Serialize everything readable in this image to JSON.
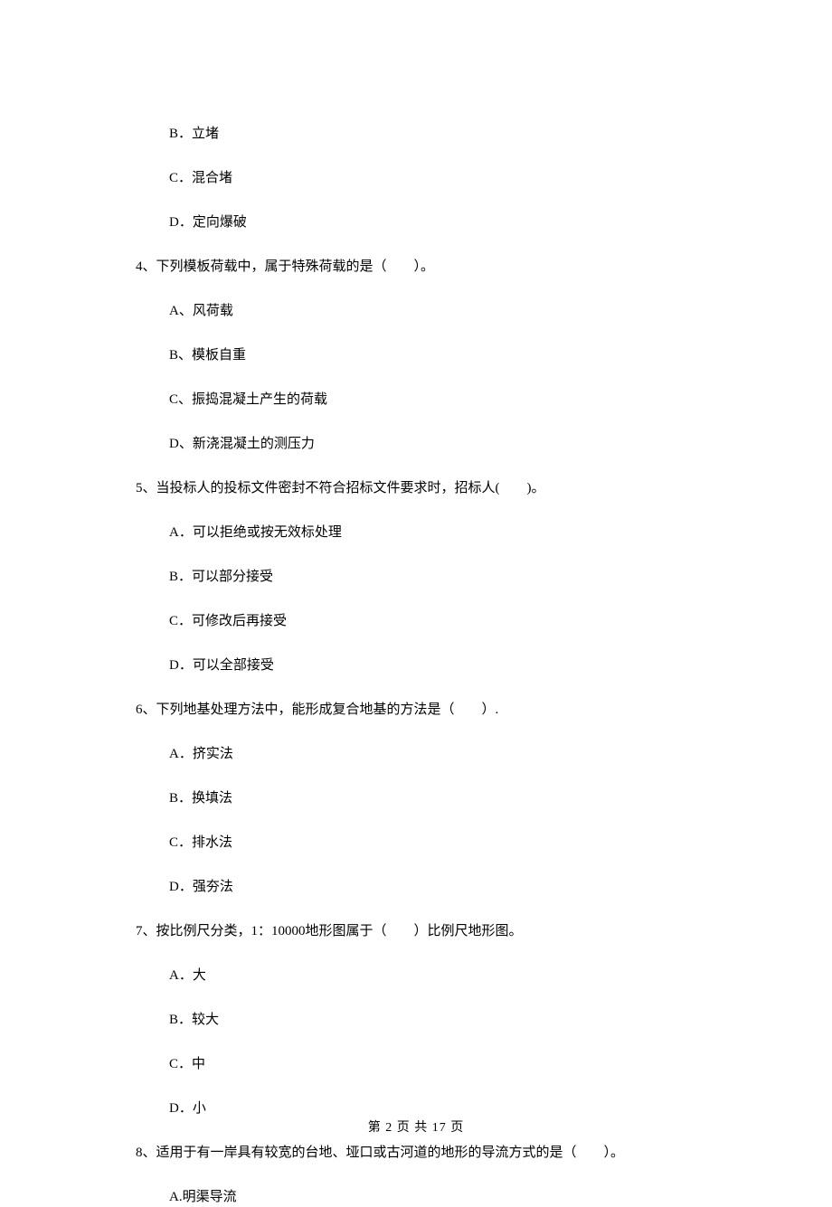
{
  "q3": {
    "B": "B．立堵",
    "C": "C．混合堵",
    "D": "D．定向爆破"
  },
  "q4": {
    "text": "4、下列模板荷载中，属于特殊荷载的是（　　）。",
    "A": "A、风荷载",
    "B": "B、模板自重",
    "C": "C、振捣混凝土产生的荷载",
    "D": "D、新浇混凝土的测压力"
  },
  "q5": {
    "text": "5、当投标人的投标文件密封不符合招标文件要求时，招标人(　　)。",
    "A": "A．可以拒绝或按无效标处理",
    "B": "B．可以部分接受",
    "C": "C．可修改后再接受",
    "D": "D．可以全部接受"
  },
  "q6": {
    "text": "6、下列地基处理方法中，能形成复合地基的方法是（　　）.",
    "A": "A．挤实法",
    "B": "B．换填法",
    "C": "C．排水法",
    "D": "D．强夯法"
  },
  "q7": {
    "text": "7、按比例尺分类，1：10000地形图属于（　　）比例尺地形图。",
    "A": "A．大",
    "B": "B．较大",
    "C": "C．中",
    "D": "D．小"
  },
  "q8": {
    "text": "8、适用于有一岸具有较宽的台地、垭口或古河道的地形的导流方式的是（　　）。",
    "A": "A.明渠导流"
  },
  "footer": "第 2 页 共 17 页"
}
